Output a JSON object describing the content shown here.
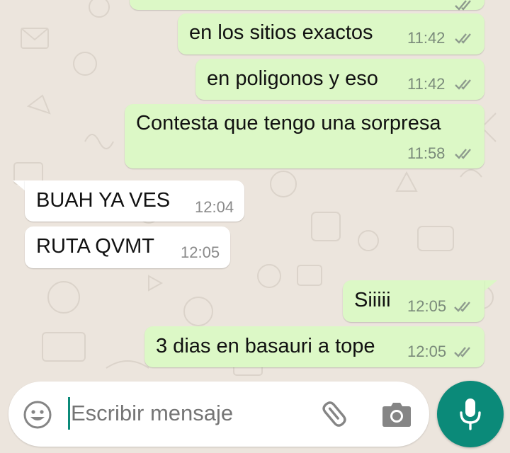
{
  "colors": {
    "chat_background": "#ece5dd",
    "outgoing_bubble": "#dcf8c6",
    "incoming_bubble": "#ffffff",
    "read_ticks": "#8e9b8e",
    "accent": "#0b8a79"
  },
  "messages": [
    {
      "direction": "outgoing",
      "text": "",
      "time": "",
      "status": "read-double-check-icon"
    },
    {
      "direction": "outgoing",
      "text": "en los sitios exactos",
      "time": "11:42",
      "status": "read-double-check-icon"
    },
    {
      "direction": "outgoing",
      "text": "en poligonos y eso",
      "time": "11:42",
      "status": "read-double-check-icon"
    },
    {
      "direction": "outgoing",
      "text": "Contesta que tengo una sorpresa",
      "time": "11:58",
      "status": "read-double-check-icon"
    },
    {
      "direction": "incoming",
      "text": "BUAH YA VES",
      "time": "12:04"
    },
    {
      "direction": "incoming",
      "text": "RUTA QVMT",
      "time": "12:05"
    },
    {
      "direction": "outgoing",
      "text": "Siiiii",
      "time": "12:05",
      "status": "read-double-check-icon"
    },
    {
      "direction": "outgoing",
      "text": "3 dias en basauri a tope",
      "time": "12:05",
      "status": "read-double-check-icon"
    }
  ],
  "composer": {
    "placeholder": "Escribir mensaje",
    "value": "",
    "icons": [
      "emoji-icon",
      "attach-icon",
      "camera-icon"
    ]
  },
  "mic_button": {
    "icon": "microphone-icon"
  }
}
